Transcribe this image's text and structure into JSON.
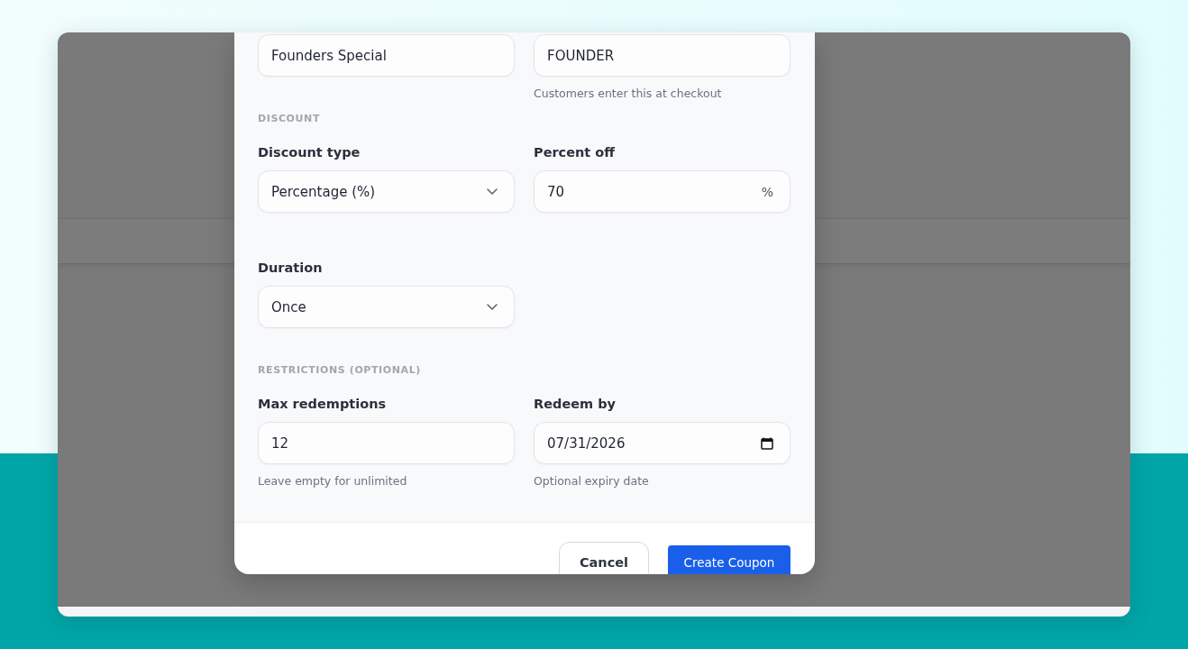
{
  "form": {
    "sections": [
      {
        "fields": [
          {
            "kind": "text",
            "value": "Founders Special"
          },
          {
            "kind": "text",
            "value": "FOUNDER",
            "hint": "Customers enter this at checkout"
          }
        ]
      },
      {
        "heading": "DISCOUNT",
        "fields": [
          {
            "kind": "select",
            "label": "Discount type",
            "value": "Percentage (%)"
          },
          {
            "kind": "text",
            "label": "Percent off",
            "value": "70",
            "suffix": "%"
          },
          {
            "kind": "select",
            "label": "Duration",
            "value": "Once"
          }
        ]
      },
      {
        "heading": "RESTRICTIONS (OPTIONAL)",
        "fields": [
          {
            "kind": "text",
            "label": "Max redemptions",
            "value": "12",
            "hint": "Leave empty for unlimited"
          },
          {
            "kind": "date",
            "label": "Redeem by",
            "value": "07/31/2026",
            "hint": "Optional expiry date"
          }
        ]
      }
    ]
  },
  "footer": {
    "buttons": [
      {
        "kind": "cancel",
        "label": "Cancel"
      },
      {
        "kind": "submit",
        "label": "Create Coupon"
      }
    ]
  }
}
